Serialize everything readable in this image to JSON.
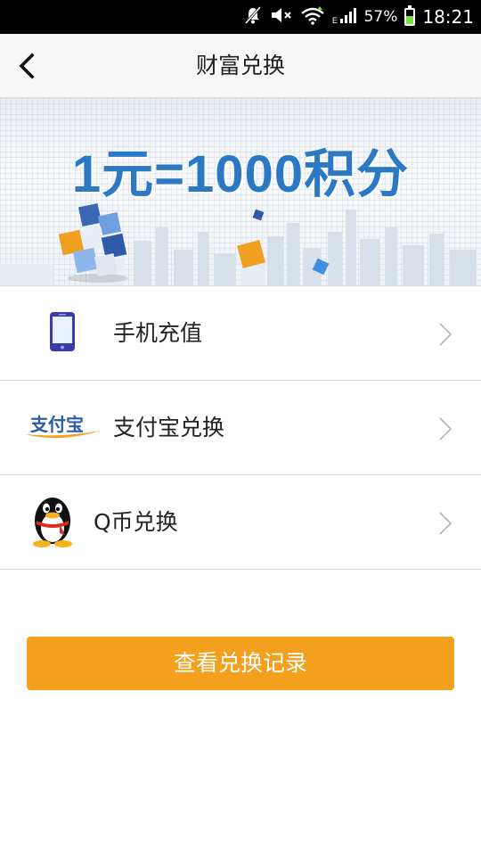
{
  "status_bar": {
    "battery_percent": "57%",
    "battery_level": 0.57,
    "time": "18:21",
    "network_type": "E",
    "icons": [
      "mute-notifications-icon",
      "volume-muted-icon",
      "wifi-icon",
      "signal-icon",
      "battery-icon"
    ]
  },
  "header": {
    "title": "财富兑换",
    "back_icon": "chevron-left-icon"
  },
  "banner": {
    "slogan": "1元=1000积分"
  },
  "list": {
    "items": [
      {
        "label": "手机充值",
        "icon": "mobile-phone-icon"
      },
      {
        "label": "支付宝兑换",
        "icon": "alipay-logo-icon",
        "logo_text": "支付宝"
      },
      {
        "label": "Q币兑换",
        "icon": "qq-penguin-icon"
      }
    ]
  },
  "actions": {
    "view_records_label": "查看兑换记录"
  },
  "colors": {
    "accent_orange": "#f2a01e",
    "slogan_blue": "#2b78c4",
    "header_bg": "#f8f8f8"
  }
}
